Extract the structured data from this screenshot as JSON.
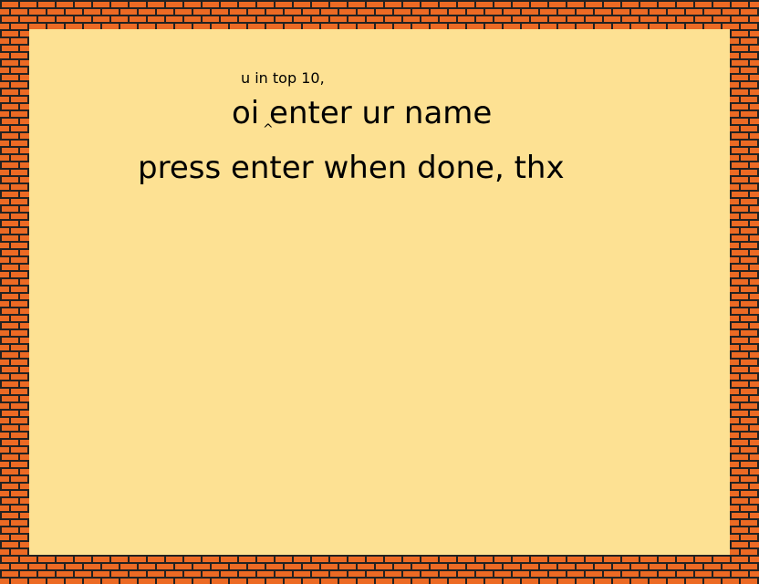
{
  "dialog": {
    "notice": "u in top 10,",
    "prompt": "oi enter ur name",
    "instruction": "press enter when done, thx",
    "caret": "^"
  },
  "colors": {
    "brick": "#ec6a24",
    "mortar": "#222222",
    "background": "#fde193",
    "text": "#000000"
  }
}
